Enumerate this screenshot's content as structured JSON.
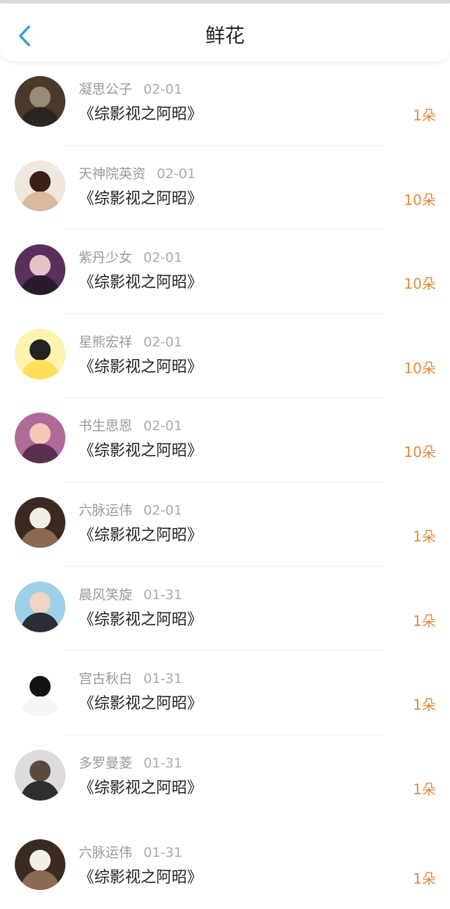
{
  "header": {
    "title": "鲜花",
    "back_icon": "chevron-left-icon",
    "accent_color": "#2d9ae8"
  },
  "rows": [
    {
      "user": "凝思公子",
      "date": "02-01",
      "book": "《综影视之阿昭》",
      "count": "1朵",
      "avatar_colors": [
        "#4a3a2c",
        "#9a8a74",
        "#2b2520"
      ]
    },
    {
      "user": "天神院英资",
      "date": "02-01",
      "book": "《综影视之阿昭》",
      "count": "10朵",
      "avatar_colors": [
        "#f0e8de",
        "#3a2018",
        "#d9b9a0"
      ]
    },
    {
      "user": "紫丹少女",
      "date": "02-01",
      "book": "《综影视之阿昭》",
      "count": "10朵",
      "avatar_colors": [
        "#5a2f5e",
        "#e2c4c8",
        "#2b1a2c"
      ]
    },
    {
      "user": "星熊宏祥",
      "date": "02-01",
      "book": "《综影视之阿昭》",
      "count": "10朵",
      "avatar_colors": [
        "#fff3b0",
        "#222222",
        "#ffe05a"
      ]
    },
    {
      "user": "书生思恩",
      "date": "02-01",
      "book": "《综影视之阿昭》",
      "count": "10朵",
      "avatar_colors": [
        "#b06a9a",
        "#f2c9b8",
        "#5b2f4f"
      ]
    },
    {
      "user": "六脉运伟",
      "date": "02-01",
      "book": "《综影视之阿昭》",
      "count": "1朵",
      "avatar_colors": [
        "#3b2a22",
        "#f4eee8",
        "#8a6a52"
      ]
    },
    {
      "user": "晨风笑旋",
      "date": "01-31",
      "book": "《综影视之阿昭》",
      "count": "1朵",
      "avatar_colors": [
        "#9fd0ea",
        "#f0d6c2",
        "#2a2e36"
      ]
    },
    {
      "user": "宫古秋白",
      "date": "01-31",
      "book": "《综影视之阿昭》",
      "count": "1朵",
      "avatar_colors": [
        "#ffffff",
        "#111111",
        "#f5f5f5"
      ]
    },
    {
      "user": "多罗曼菱",
      "date": "01-31",
      "book": "《综影视之阿昭》",
      "count": "1朵",
      "avatar_colors": [
        "#dcdcdc",
        "#5c4a3c",
        "#2f2f2f"
      ]
    },
    {
      "user": "六脉运伟",
      "date": "01-31",
      "book": "《综影视之阿昭》",
      "count": "1朵",
      "avatar_colors": [
        "#3b2a22",
        "#f4eee8",
        "#8a6a52"
      ]
    }
  ]
}
